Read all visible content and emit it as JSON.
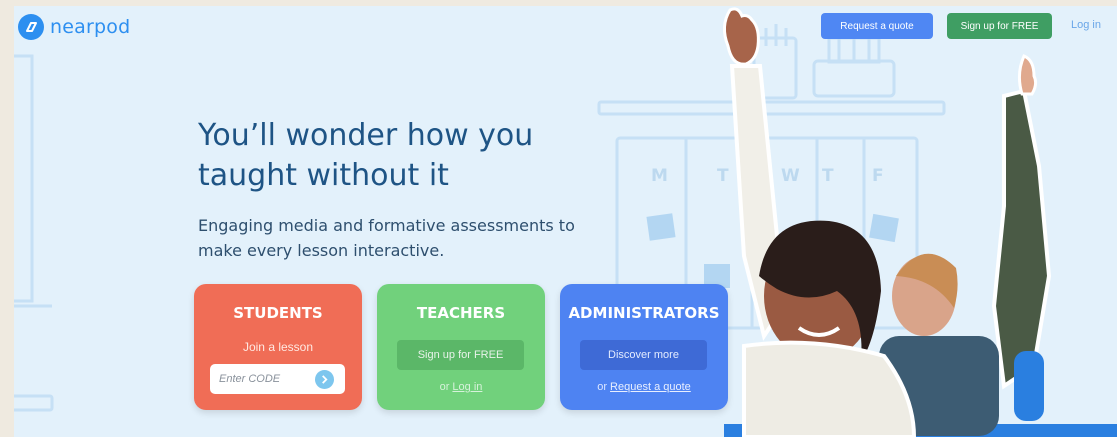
{
  "brand": {
    "name": "nearpod",
    "color": "#2d8ff0"
  },
  "header": {
    "request_quote_label": "Request a quote",
    "signup_label": "Sign up for FREE",
    "login_label": "Log in"
  },
  "hero": {
    "headline": "You’ll wonder how you taught without it",
    "subhead": "Engaging media and formative assessments to make every lesson interactive."
  },
  "background": {
    "calendar_days": [
      "M",
      "T",
      "W",
      "T",
      "F"
    ]
  },
  "cards": {
    "students": {
      "title": "STUDENTS",
      "subtitle": "Join a lesson",
      "input_placeholder": "Enter CODE",
      "color": "#f06d56"
    },
    "teachers": {
      "title": "TEACHERS",
      "button_label": "Sign up for FREE",
      "footer_prefix": "or",
      "footer_link": "Log in",
      "color": "#71d17c"
    },
    "admins": {
      "title": "ADMINISTRATORS",
      "button_label": "Discover more",
      "footer_prefix": "or",
      "footer_link": "Request a quote",
      "color": "#4e83f2"
    }
  },
  "icons": {
    "logo": "nearpod-logo-icon",
    "code_submit": "chevron-right-icon"
  }
}
